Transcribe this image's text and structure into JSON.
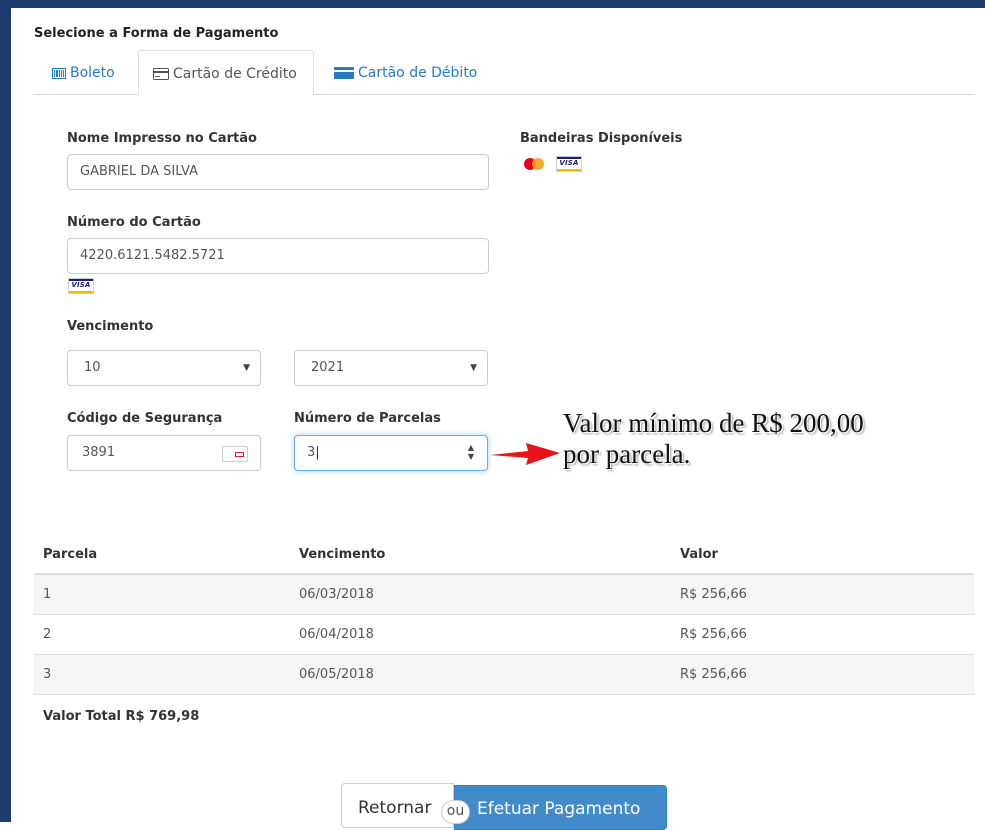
{
  "section_title": "Selecione a Forma de Pagamento",
  "tabs": [
    {
      "label": "Boleto",
      "icon": "barcode-icon",
      "active": false
    },
    {
      "label": "Cartão de Crédito",
      "icon": "credit-card-icon",
      "active": true
    },
    {
      "label": "Cartão de Débito",
      "icon": "debit-card-icon",
      "active": false
    }
  ],
  "form": {
    "name_label": "Nome Impresso no Cartão",
    "name_value": "GABRIEL DA SILVA",
    "number_label": "Número do Cartão",
    "number_value": "4220.6121.5482.5721",
    "brands_label": "Bandeiras Disponíveis",
    "expiry_label": "Vencimento",
    "expiry_month": "10",
    "expiry_year": "2021",
    "cvv_label": "Código de Segurança",
    "cvv_value": "3891",
    "installments_label": "Número de Parcelas",
    "installments_value": "3",
    "visa_text": "VISA"
  },
  "annotation": {
    "text_line1": "Valor mínimo de R$ 200,00",
    "text_line2": "por parcela.",
    "arrow_color": "#e8141b"
  },
  "installments_table": {
    "headers": [
      "Parcela",
      "Vencimento",
      "Valor"
    ],
    "rows": [
      [
        "1",
        "06/03/2018",
        "R$ 256,66"
      ],
      [
        "2",
        "06/04/2018",
        "R$ 256,66"
      ],
      [
        "3",
        "06/05/2018",
        "R$ 256,66"
      ]
    ]
  },
  "total": "Valor Total R$ 769,98",
  "buttons": {
    "return_label": "Retornar",
    "or_label": "ou",
    "pay_label": "Efetuar Pagamento"
  },
  "colors": {
    "primary": "#428bca",
    "link": "#2a78c8",
    "frame": "#1c3c6e"
  }
}
